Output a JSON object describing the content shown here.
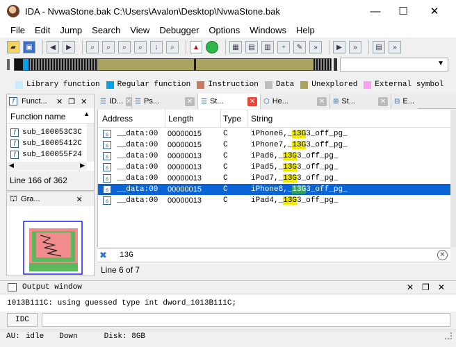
{
  "window": {
    "title": "IDA - NvwaStone.bak C:\\Users\\Avalon\\Desktop\\NvwaStone.bak",
    "minimize": "—",
    "maximize": "☐",
    "close": "✕"
  },
  "menu": [
    "File",
    "Edit",
    "Jump",
    "Search",
    "View",
    "Debugger",
    "Options",
    "Windows",
    "Help"
  ],
  "legend": [
    {
      "label": "Library function",
      "color": "#c9ecff"
    },
    {
      "label": "Regular function",
      "color": "#0aa0e8"
    },
    {
      "label": "Instruction",
      "color": "#c87b62"
    },
    {
      "label": "Data",
      "color": "#bdbdbd"
    },
    {
      "label": "Unexplored",
      "color": "#a8a35e"
    },
    {
      "label": "External symbol",
      "color": "#ff9ef5"
    }
  ],
  "functions": {
    "title": "Funct...",
    "header": "Function name",
    "items": [
      "sub_100053C3C",
      "sub_10005412C",
      "sub_100055F24"
    ],
    "status": "Line 166 of 362"
  },
  "graph": {
    "title": "Gra..."
  },
  "tabs": [
    "ID...",
    "Ps...",
    "St...",
    "He...",
    "St...",
    "E..."
  ],
  "strings": {
    "columns": [
      "Address",
      "Length",
      "Type",
      "String"
    ],
    "rows": [
      {
        "address": "__data:00",
        "length": "00000015",
        "type": "C",
        "pre": "iPhone6,_",
        "match": "13G",
        "post": "3_off_pg_"
      },
      {
        "address": "__data:00",
        "length": "00000015",
        "type": "C",
        "pre": "iPhone7,_",
        "match": "13G",
        "post": "3_off_pg_"
      },
      {
        "address": "__data:00",
        "length": "00000013",
        "type": "C",
        "pre": "iPad6,_",
        "match": "13G",
        "post": "3_off_pg_"
      },
      {
        "address": "__data:00",
        "length": "00000013",
        "type": "C",
        "pre": "iPad5,_",
        "match": "13G",
        "post": "3_off_pg_"
      },
      {
        "address": "__data:00",
        "length": "00000013",
        "type": "C",
        "pre": "iPod7,_",
        "match": "13G",
        "post": "3_off_pg_"
      },
      {
        "address": "__data:00",
        "length": "00000015",
        "type": "C",
        "pre": "iPhone8,_",
        "match": "13G",
        "post": "3_off_pg_"
      },
      {
        "address": "__data:00",
        "length": "00000013",
        "type": "C",
        "pre": "iPad4,_",
        "match": "13G",
        "post": "3_off_pg_"
      }
    ],
    "selected_row": 5,
    "filter": "13G",
    "status": "Line 6 of 7"
  },
  "output": {
    "title": "Output window",
    "text": "1013B111C: using guessed type int dword_1013B111C;",
    "idc_label": "IDC"
  },
  "statusbar": {
    "au": "AU:",
    "state": "idle",
    "direction": "Down",
    "disk": "Disk: 8GB"
  }
}
